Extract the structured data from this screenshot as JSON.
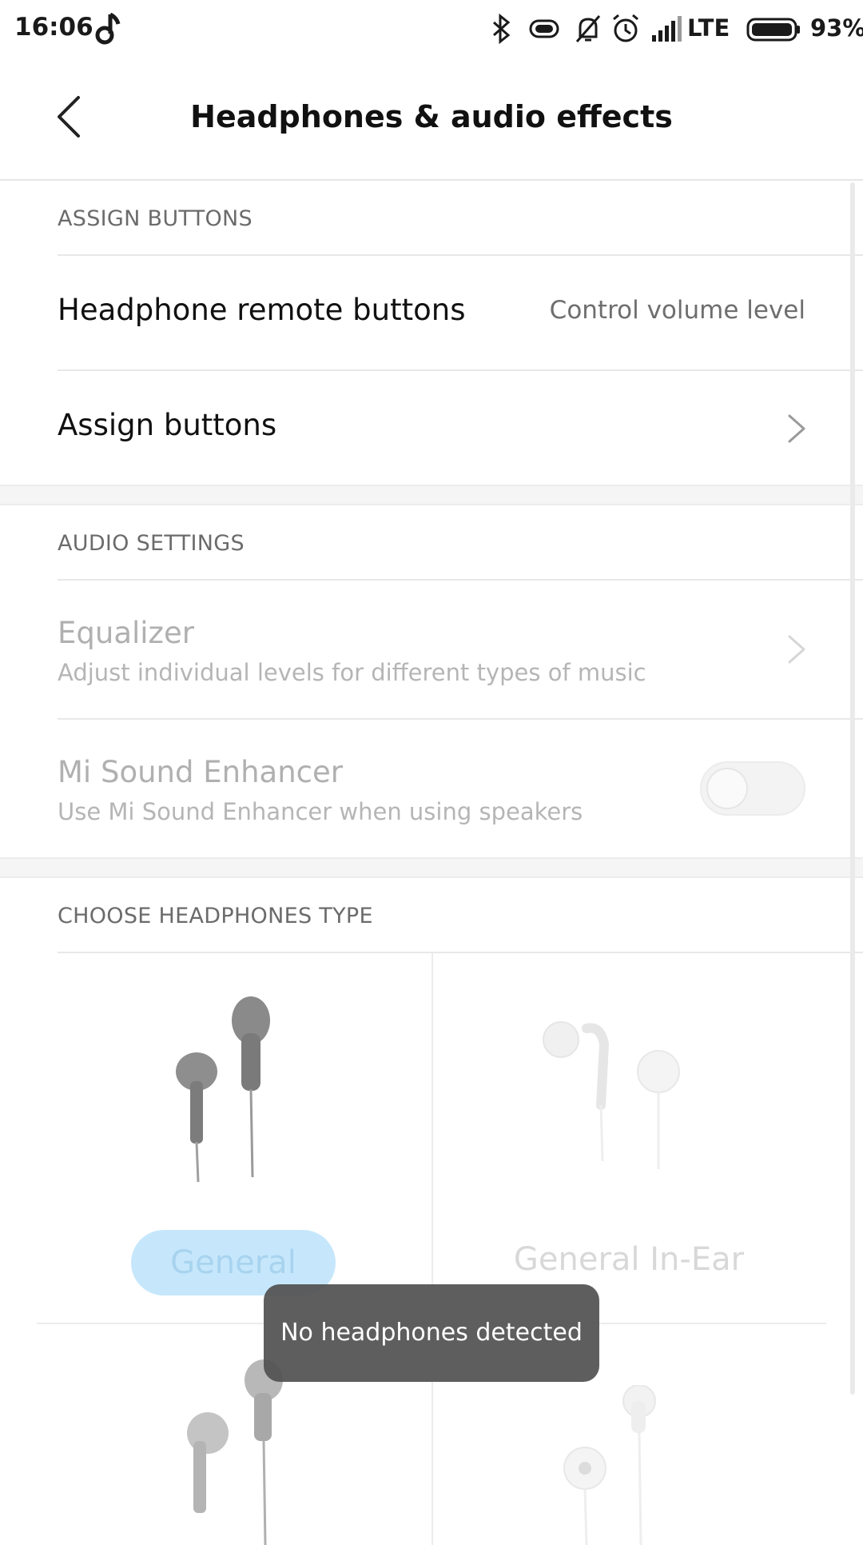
{
  "status_bar": {
    "time": "16:06",
    "network": "LTE",
    "battery_percent": "93%",
    "icons": [
      "music-note-icon",
      "bluetooth-icon",
      "vibrate-icon",
      "bell-off-icon",
      "alarm-icon",
      "signal-icon",
      "battery-icon"
    ]
  },
  "header": {
    "title": "Headphones & audio effects"
  },
  "sections": {
    "assign_buttons": {
      "header": "ASSIGN BUTTONS",
      "remote_title": "Headphone remote buttons",
      "remote_value": "Control volume level",
      "assign_title": "Assign buttons"
    },
    "audio_settings": {
      "header": "AUDIO SETTINGS",
      "equalizer_title": "Equalizer",
      "equalizer_sub": "Adjust individual levels for different types of music",
      "enhancer_title": "Mi Sound Enhancer",
      "enhancer_sub": "Use Mi Sound Enhancer when using speakers",
      "enhancer_on": false
    },
    "headphones_type": {
      "header": "CHOOSE HEADPHONES TYPE",
      "types": [
        "General",
        "General In-Ear"
      ]
    }
  },
  "toast": {
    "message": "No headphones detected"
  },
  "colors": {
    "accent_light": "#c6e7fb",
    "toast_bg": "#505050"
  }
}
